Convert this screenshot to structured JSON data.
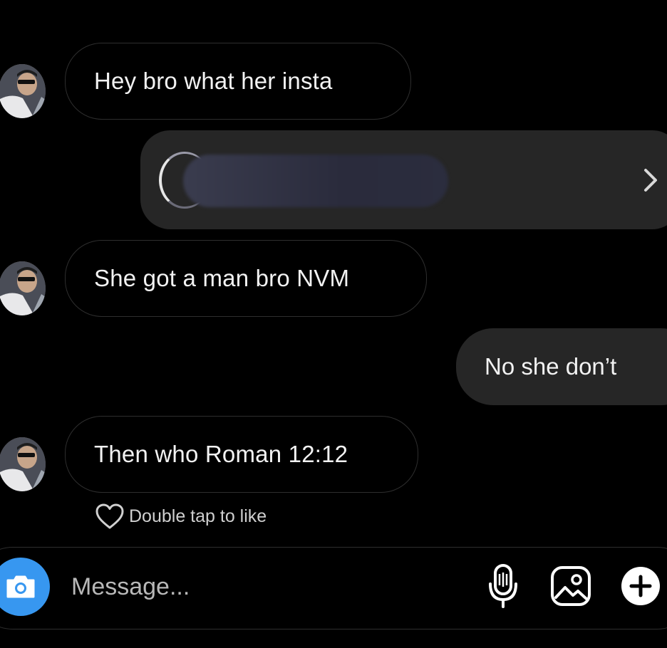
{
  "thread": {
    "messages": [
      {
        "direction": "incoming",
        "text": "Hey bro what her insta"
      },
      {
        "direction": "outgoing",
        "type": "shared_profile"
      },
      {
        "direction": "incoming",
        "text": "She got a man bro NVM"
      },
      {
        "direction": "outgoing",
        "text": "No she don’t"
      },
      {
        "direction": "incoming",
        "text": "Then who Roman 12:12"
      }
    ],
    "like_hint": "Double tap to like"
  },
  "composer": {
    "placeholder": "Message...",
    "icons": [
      "camera-icon",
      "microphone-icon",
      "gallery-icon",
      "plus-icon"
    ]
  },
  "colors": {
    "background": "#000000",
    "outgoing_bubble": "#262626",
    "incoming_border": "#2e2e2e",
    "camera_button": "#3797f0"
  }
}
